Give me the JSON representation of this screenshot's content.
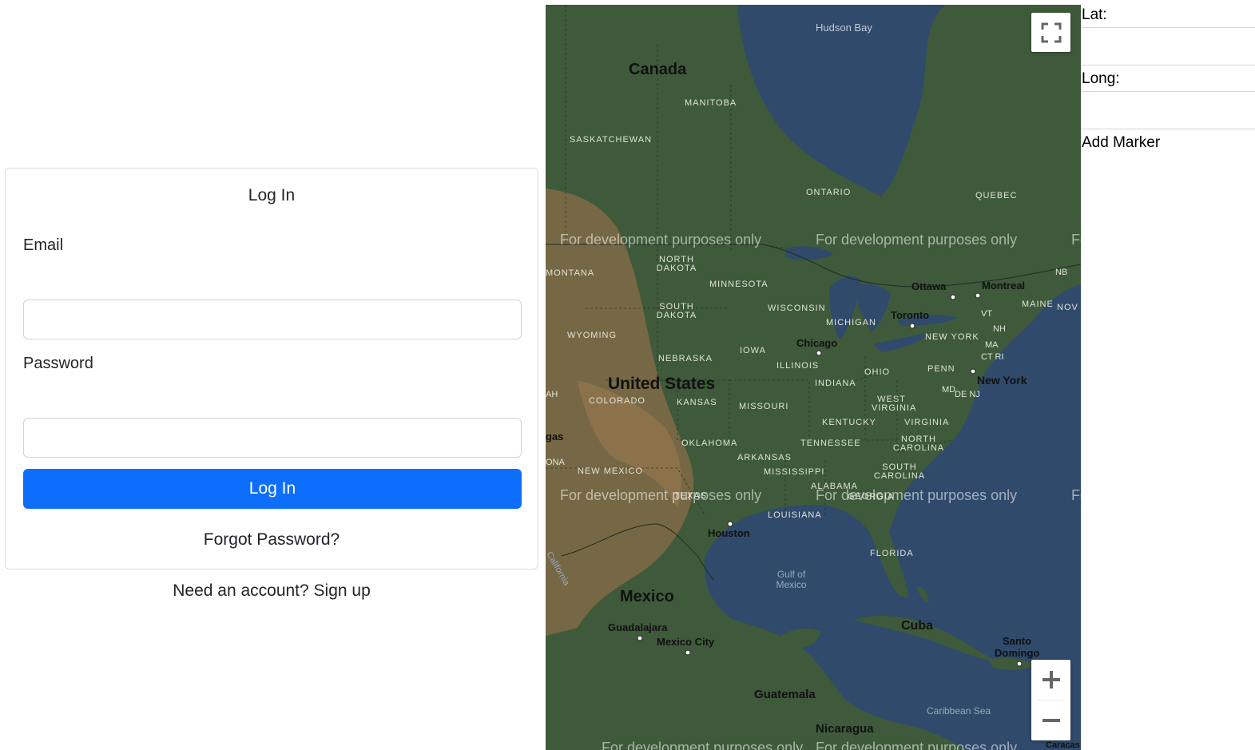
{
  "login": {
    "title": "Log In",
    "email_label": "Email",
    "email_value": "",
    "password_label": "Password",
    "password_value": "",
    "submit_label": "Log In",
    "forgot_label": "Forgot Password?",
    "signup_label": "Need an account? Sign up",
    "accent_color": "#0d6efd"
  },
  "map": {
    "fullscreen_icon": "fullscreen-icon",
    "zoom_in_icon": "plus-icon",
    "zoom_out_icon": "minus-icon",
    "watermark": "For development purposes only",
    "labels": {
      "hudson_bay": "Hudson Bay",
      "canada": "Canada",
      "manitoba": "MANITOBA",
      "saskatchewan": "SASKATCHEWAN",
      "ontario": "ONTARIO",
      "quebec": "QUEBEC",
      "north_dakota": "NORTH DAKOTA",
      "montana": "MONTANA",
      "minnesota": "MINNESOTA",
      "south_dakota": "SOUTH DAKOTA",
      "wisconsin": "WISCONSIN",
      "michigan": "MICHIGAN",
      "wyoming": "WYOMING",
      "nebraska": "NEBRASKA",
      "iowa": "IOWA",
      "illinois": "ILLINOIS",
      "indiana": "INDIANA",
      "ohio": "OHIO",
      "penn": "PENN",
      "new_york_state": "NEW YORK",
      "united_states": "United States",
      "colorado": "COLORADO",
      "kansas": "KANSAS",
      "missouri": "MISSOURI",
      "kentucky": "KENTUCKY",
      "west_virginia": "WEST VIRGINIA",
      "virginia": "VIRGINIA",
      "oklahoma": "OKLAHOMA",
      "tennessee": "TENNESSEE",
      "north_carolina": "NORTH CAROLINA",
      "arkansas": "ARKANSAS",
      "new_mexico": "NEW MEXICO",
      "mississippi": "MISSISSIPPI",
      "alabama": "ALABAMA",
      "south_carolina": "SOUTH CAROLINA",
      "georgia": "GEORGIA",
      "texas": "TEXAS",
      "louisiana": "LOUISIANA",
      "florida": "FLORIDA",
      "gulf_of_mexico": "Gulf of Mexico",
      "mexico": "Mexico",
      "guadalajara": "Guadalajara",
      "mexico_city": "Mexico City",
      "cuba": "Cuba",
      "santo_domingo": "Santo Domingo",
      "guatemala": "Guatemala",
      "nicaragua": "Nicaragua",
      "caribbean_sea": "Caribbean Sea",
      "houston": "Houston",
      "chicago": "Chicago",
      "toronto": "Toronto",
      "ottawa": "Ottawa",
      "montreal": "Montreal",
      "new_york_city": "New York",
      "nb": "NB",
      "maine": "MAINE",
      "nova": "NOV",
      "vt": "VT",
      "nh": "NH",
      "ma": "MA",
      "ct_ri": "CT RI",
      "md": "MD",
      "de_nj": "DE NJ",
      "vegas": "gas",
      "utah": "AH",
      "arizona": "ONA",
      "california": "California",
      "caracas": "Caracas"
    }
  },
  "marker_form": {
    "lat_label": "Lat:",
    "lat_value": "",
    "long_label": "Long:",
    "long_value": "",
    "add_label": "Add Marker"
  }
}
